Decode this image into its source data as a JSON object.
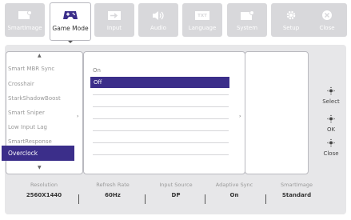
{
  "toolbar": {
    "tabs": [
      {
        "label": "SmartImage",
        "icon": "smartimage-icon"
      },
      {
        "label": "Game Mode",
        "icon": "gamepad-icon"
      },
      {
        "label": "Input",
        "icon": "input-icon"
      },
      {
        "label": "Audio",
        "icon": "speaker-icon"
      },
      {
        "label": "Language",
        "icon": "txt-icon"
      },
      {
        "label": "System",
        "icon": "system-icon"
      },
      {
        "label": "Setup",
        "icon": "gear-icon"
      },
      {
        "label": "Close",
        "icon": "close-icon"
      }
    ],
    "active": "Game Mode"
  },
  "menu": {
    "items": [
      "Smart MBR Sync",
      "Crosshair",
      "StarkShadowBoost",
      "Smart Sniper",
      "Low Input Lag",
      "SmartResponse",
      "Overclock"
    ],
    "selected": "Overclock"
  },
  "options": {
    "items": [
      "On",
      "Off"
    ],
    "selected": "Off"
  },
  "side_buttons": {
    "select": "Select",
    "ok": "OK",
    "close": "Close"
  },
  "status": [
    {
      "label": "Resolution",
      "value": "2560X1440"
    },
    {
      "label": "Refresh Rate",
      "value": "60Hz"
    },
    {
      "label": "Input Source",
      "value": "DP"
    },
    {
      "label": "Adaptive Sync",
      "value": "On"
    },
    {
      "label": "SmartImage",
      "value": "Standard"
    }
  ],
  "colors": {
    "accent": "#3b2e8a",
    "tab_bg": "#d8d8db",
    "frame_bg": "#e7e7e9"
  }
}
